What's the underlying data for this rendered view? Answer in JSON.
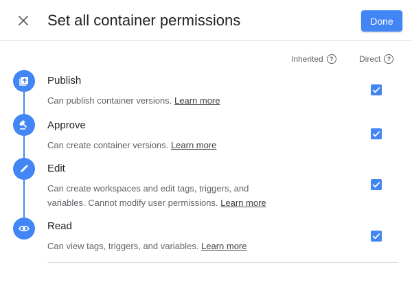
{
  "dialog": {
    "title": "Set all container permissions",
    "done_label": "Done"
  },
  "columns": {
    "inherited": "Inherited",
    "direct": "Direct",
    "help_icon": "question-circle-icon"
  },
  "permissions": [
    {
      "title": "Publish",
      "desc": "Can publish container versions.",
      "link": "Learn more",
      "icon": "publish-icon",
      "direct_checked": true
    },
    {
      "title": "Approve",
      "desc": "Can create container versions.",
      "link": "Learn more",
      "icon": "gavel-icon",
      "direct_checked": true
    },
    {
      "title": "Edit",
      "desc": "Can create workspaces and edit tags, triggers, and variables. Cannot modify user permissions.",
      "link": "Learn more",
      "icon": "pencil-icon",
      "direct_checked": true
    },
    {
      "title": "Read",
      "desc": "Can view tags, triggers, and variables.",
      "link": "Learn more",
      "icon": "eye-icon",
      "direct_checked": true
    }
  ],
  "colors": {
    "accent": "#4285f4",
    "text": "#202124",
    "secondary_text": "#5f6368",
    "divider": "#dadce0"
  }
}
